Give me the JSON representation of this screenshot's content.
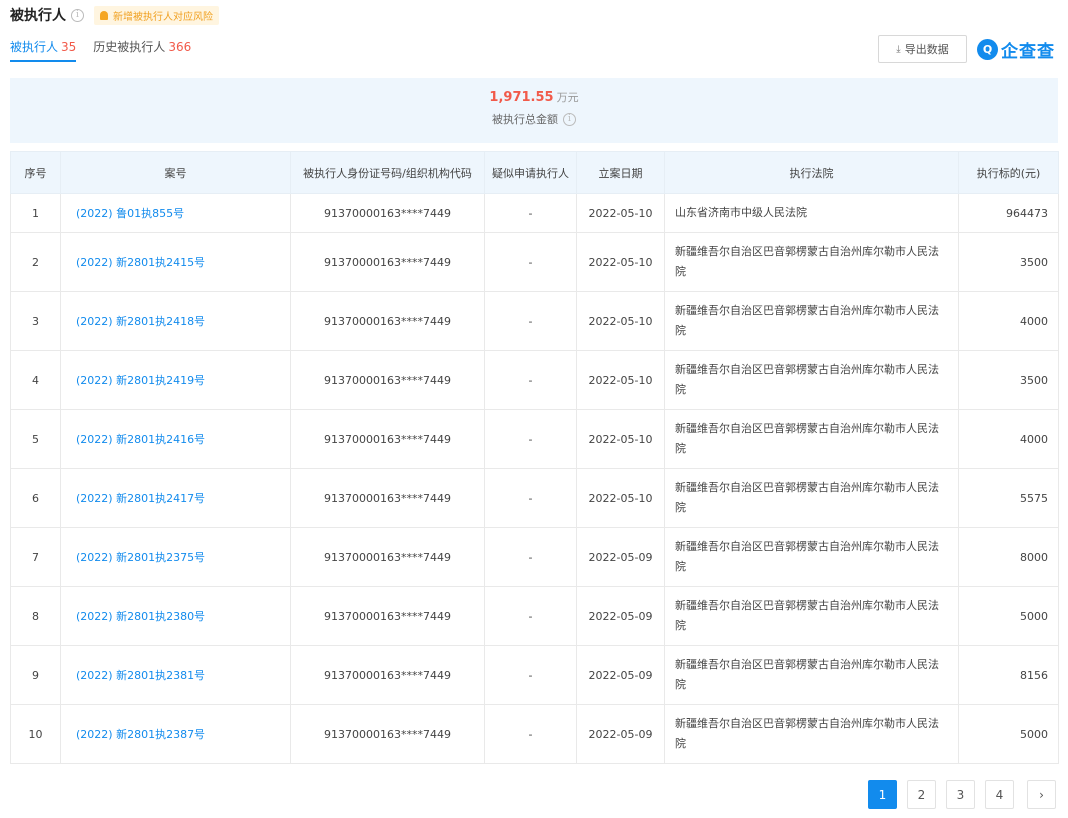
{
  "header": {
    "title": "被执行人",
    "notice": "新增被执行人对应风险"
  },
  "tabs": [
    {
      "label": "被执行人",
      "count": "35"
    },
    {
      "label": "历史被执行人",
      "count": "366"
    }
  ],
  "toolbar": {
    "export_label": "导出数据",
    "logo_text": "企查查"
  },
  "summary": {
    "amount": "1,971.55",
    "unit": "万元",
    "label": "被执行总金额"
  },
  "table": {
    "columns": [
      "序号",
      "案号",
      "被执行人身份证号码/组织机构代码",
      "疑似申请执行人",
      "立案日期",
      "执行法院",
      "执行标的(元)"
    ],
    "rows": [
      {
        "no": "1",
        "case": "(2022) 鲁01执855号",
        "id_code": "91370000163****7449",
        "applicant": "-",
        "date": "2022-05-10",
        "court": "山东省济南市中级人民法院",
        "amount": "964473"
      },
      {
        "no": "2",
        "case": "(2022) 新2801执2415号",
        "id_code": "91370000163****7449",
        "applicant": "-",
        "date": "2022-05-10",
        "court": "新疆维吾尔自治区巴音郭楞蒙古自治州库尔勒市人民法院",
        "amount": "3500"
      },
      {
        "no": "3",
        "case": "(2022) 新2801执2418号",
        "id_code": "91370000163****7449",
        "applicant": "-",
        "date": "2022-05-10",
        "court": "新疆维吾尔自治区巴音郭楞蒙古自治州库尔勒市人民法院",
        "amount": "4000"
      },
      {
        "no": "4",
        "case": "(2022) 新2801执2419号",
        "id_code": "91370000163****7449",
        "applicant": "-",
        "date": "2022-05-10",
        "court": "新疆维吾尔自治区巴音郭楞蒙古自治州库尔勒市人民法院",
        "amount": "3500"
      },
      {
        "no": "5",
        "case": "(2022) 新2801执2416号",
        "id_code": "91370000163****7449",
        "applicant": "-",
        "date": "2022-05-10",
        "court": "新疆维吾尔自治区巴音郭楞蒙古自治州库尔勒市人民法院",
        "amount": "4000"
      },
      {
        "no": "6",
        "case": "(2022) 新2801执2417号",
        "id_code": "91370000163****7449",
        "applicant": "-",
        "date": "2022-05-10",
        "court": "新疆维吾尔自治区巴音郭楞蒙古自治州库尔勒市人民法院",
        "amount": "5575"
      },
      {
        "no": "7",
        "case": "(2022) 新2801执2375号",
        "id_code": "91370000163****7449",
        "applicant": "-",
        "date": "2022-05-09",
        "court": "新疆维吾尔自治区巴音郭楞蒙古自治州库尔勒市人民法院",
        "amount": "8000"
      },
      {
        "no": "8",
        "case": "(2022) 新2801执2380号",
        "id_code": "91370000163****7449",
        "applicant": "-",
        "date": "2022-05-09",
        "court": "新疆维吾尔自治区巴音郭楞蒙古自治州库尔勒市人民法院",
        "amount": "5000"
      },
      {
        "no": "9",
        "case": "(2022) 新2801执2381号",
        "id_code": "91370000163****7449",
        "applicant": "-",
        "date": "2022-05-09",
        "court": "新疆维吾尔自治区巴音郭楞蒙古自治州库尔勒市人民法院",
        "amount": "8156"
      },
      {
        "no": "10",
        "case": "(2022) 新2801执2387号",
        "id_code": "91370000163****7449",
        "applicant": "-",
        "date": "2022-05-09",
        "court": "新疆维吾尔自治区巴音郭楞蒙古自治州库尔勒市人民法院",
        "amount": "5000"
      }
    ]
  },
  "pagination": {
    "pages": [
      "1",
      "2",
      "3",
      "4"
    ],
    "current": "1",
    "next_icon": "chevron-right-icon",
    "next_glyph": "›"
  },
  "colors": {
    "accent": "#128bed",
    "highlight": "#f15a4a",
    "header_bg": "#eef6fd"
  }
}
